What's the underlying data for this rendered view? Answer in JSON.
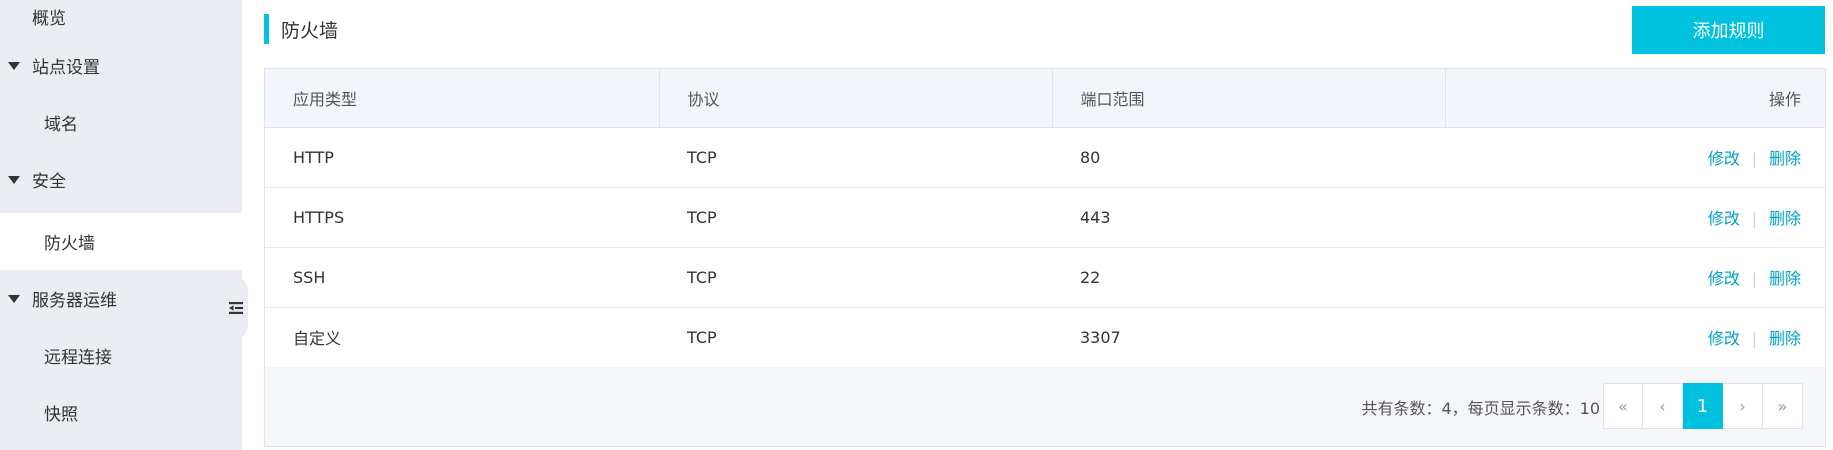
{
  "sidebar": {
    "items": [
      {
        "label": "概览",
        "type": "top"
      },
      {
        "label": "站点设置",
        "type": "group"
      },
      {
        "label": "域名",
        "type": "sub"
      },
      {
        "label": "安全",
        "type": "group"
      },
      {
        "label": "防火墙",
        "type": "sub",
        "active": true
      },
      {
        "label": "服务器运维",
        "type": "group"
      },
      {
        "label": "远程连接",
        "type": "sub"
      },
      {
        "label": "快照",
        "type": "sub"
      }
    ]
  },
  "header": {
    "title": "防火墙",
    "add_button_label": "添加规则"
  },
  "table": {
    "columns": [
      "应用类型",
      "协议",
      "端口范围",
      "操作"
    ],
    "rows": [
      {
        "app": "HTTP",
        "protocol": "TCP",
        "port": "80",
        "edit": "修改",
        "sep": "|",
        "delete": "删除"
      },
      {
        "app": "HTTPS",
        "protocol": "TCP",
        "port": "443",
        "edit": "修改",
        "sep": "|",
        "delete": "删除"
      },
      {
        "app": "SSH",
        "protocol": "TCP",
        "port": "22",
        "edit": "修改",
        "sep": "|",
        "delete": "删除"
      },
      {
        "app": "自定义",
        "protocol": "TCP",
        "port": "3307",
        "edit": "修改",
        "sep": "|",
        "delete": "删除"
      }
    ]
  },
  "pagination": {
    "summary": "共有条数：4，每页显示条数：10",
    "first": "«",
    "prev": "‹",
    "current": "1",
    "next": "›",
    "last": "»"
  },
  "colors": {
    "accent": "#00c1de",
    "link": "#00a2ca",
    "sidebar_bg": "#eaedf1"
  },
  "icons": {
    "collapse": "collapse-sidebar-icon",
    "group_expanded": "caret-down-icon"
  }
}
